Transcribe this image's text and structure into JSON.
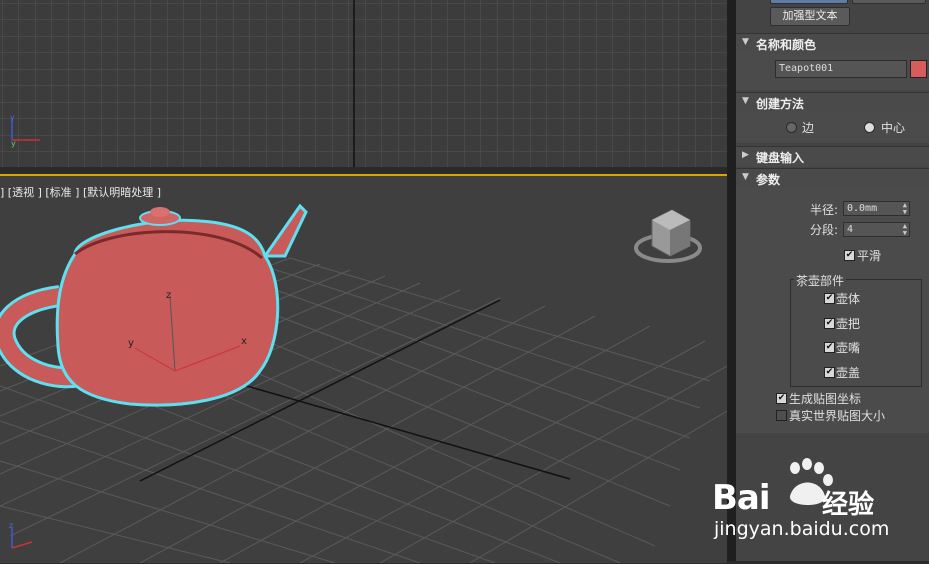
{
  "viewport_label": "[ + ] [透视 ] [标准 ] [默认明暗处理 ]",
  "viewport_label_visible": "] [透视 ] [标准 ] [默认明暗处理 ]",
  "axis": {
    "x": "x",
    "y": "y",
    "z": "z"
  },
  "panel": {
    "extended_text_button": "加强型文本",
    "name_color": {
      "title": "名称和颜色",
      "object_name": "Teapot001",
      "color": "#d95c5c"
    },
    "creation_method": {
      "title": "创建方法",
      "edge": "边",
      "center": "中心",
      "selected": "center"
    },
    "keyboard_input": {
      "title": "键盘输入"
    },
    "parameters": {
      "title": "参数",
      "radius_label": "半径:",
      "radius_value": "0.0mm",
      "segments_label": "分段:",
      "segments_value": "4",
      "smooth_label": "平滑",
      "smooth": true,
      "parts_title": "茶壶部件",
      "parts": [
        {
          "label": "壶体",
          "checked": true
        },
        {
          "label": "壶把",
          "checked": true
        },
        {
          "label": "壶嘴",
          "checked": true
        },
        {
          "label": "壶盖",
          "checked": true
        }
      ],
      "gen_map_coords": "生成贴图坐标",
      "gen_map_coords_checked": true,
      "real_world_map": "真实世界贴图大小",
      "real_world_map_checked": false
    }
  },
  "watermark": {
    "brand": "Bai",
    "brand2": "经验",
    "url": "jingyan.baidu.com"
  },
  "colors": {
    "teapot": "#c95a5a",
    "selection": "#5fe0f0",
    "accent": "#d8a600"
  }
}
